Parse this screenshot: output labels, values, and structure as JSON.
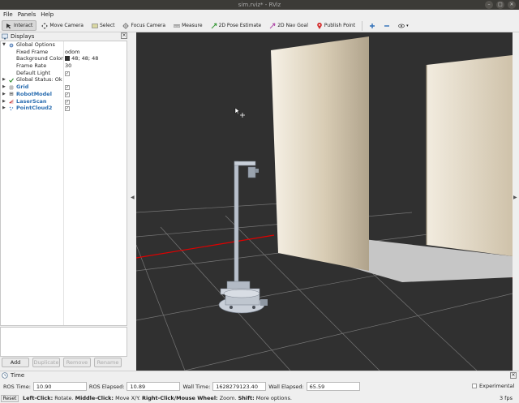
{
  "window": {
    "title": "sim.rviz* - RViz"
  },
  "menu": [
    "File",
    "Panels",
    "Help"
  ],
  "toolbar": {
    "tools": [
      "Interact",
      "Move Camera",
      "Select",
      "Focus Camera",
      "Measure",
      "2D Pose Estimate",
      "2D Nav Goal",
      "Publish Point"
    ]
  },
  "displays_panel": {
    "title": "Displays",
    "global_options": {
      "label": "Global Options",
      "fixed_frame_key": "Fixed Frame",
      "fixed_frame_val": "odom",
      "background_key": "Background Color",
      "background_val": "48; 48; 48",
      "frame_rate_key": "Frame Rate",
      "frame_rate_val": "30",
      "default_light_key": "Default Light"
    },
    "global_status": "Global Status: Ok",
    "items": [
      "Grid",
      "RobotModel",
      "LaserScan",
      "PointCloud2"
    ],
    "buttons": {
      "add": "Add",
      "duplicate": "Duplicate",
      "remove": "Remove",
      "rename": "Rename"
    }
  },
  "time_panel": {
    "title": "Time",
    "ros_time_label": "ROS Time:",
    "ros_time": "10.90",
    "ros_elapsed_label": "ROS Elapsed:",
    "ros_elapsed": "10.89",
    "wall_time_label": "Wall Time:",
    "wall_time": "1628279123.40",
    "wall_elapsed_label": "Wall Elapsed:",
    "wall_elapsed": "65.59",
    "experimental": "Experimental"
  },
  "status": {
    "reset": "Reset",
    "hint_b1": "Left-Click:",
    "hint_t1": " Rotate. ",
    "hint_b2": "Middle-Click:",
    "hint_t2": " Move X/Y. ",
    "hint_b3": "Right-Click/Mouse Wheel:",
    "hint_t3": " Zoom. ",
    "hint_b4": "Shift:",
    "hint_t4": " More options.",
    "fps": "3 fps"
  },
  "colors": {
    "viewport_bg": "#303030",
    "grid_line": "#7a7a7a",
    "axis_red": "#e00000",
    "wall_light": "#f4efe3",
    "wall_dark": "#a89c86",
    "floor_patch": "#c4c4c4"
  }
}
